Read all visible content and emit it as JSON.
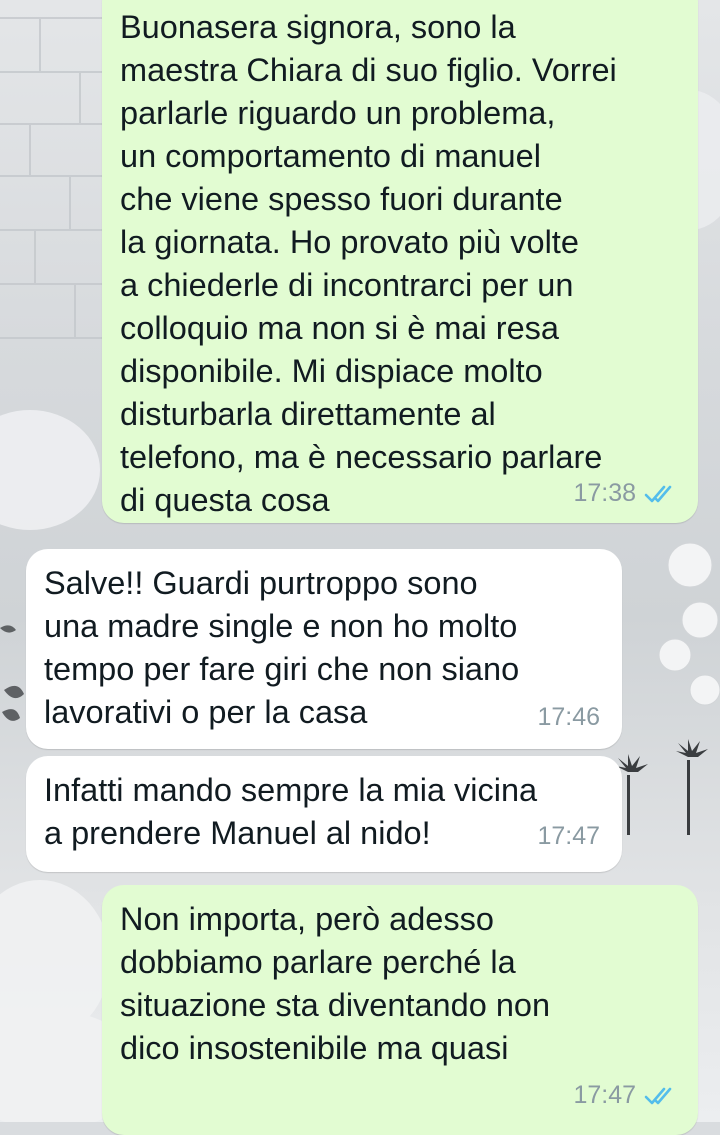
{
  "messages": [
    {
      "direction": "outgoing",
      "text": "Buonasera signora, sono la\nmaestra Chiara di suo figlio. Vorrei\nparlarle riguardo un problema,\nun comportamento di manuel\nche viene spesso fuori durante\nla giornata. Ho provato più volte\na chiederle di incontrarci per un\ncolloquio ma non si è mai resa\ndisponibile. Mi dispiace molto\ndisturbarla direttamente al\ntelefono, ma è necessario parlare\ndi questa cosa",
      "time": "17:38",
      "read": true
    },
    {
      "direction": "incoming",
      "text": "Salve!! Guardi purtroppo sono\nuna madre single e non ho molto\ntempo per fare giri che non siano\nlavorativi o per la casa",
      "time": "17:46"
    },
    {
      "direction": "incoming",
      "text": "Infatti mando sempre la mia vicina\na prendere Manuel al nido!",
      "time": "17:47"
    },
    {
      "direction": "outgoing",
      "text": "Non importa, però adesso\ndobbiamo parlare perché la\nsituazione sta diventando non\ndico insostenibile ma quasi",
      "time": "17:47",
      "read": true
    }
  ],
  "colors": {
    "outgoing_bubble": "#e2fcd2",
    "incoming_bubble": "#ffffff",
    "read_ticks": "#53bdeb",
    "timestamp": "#8a9aa2"
  },
  "icons": {
    "read_receipt": "double-check-icon"
  }
}
